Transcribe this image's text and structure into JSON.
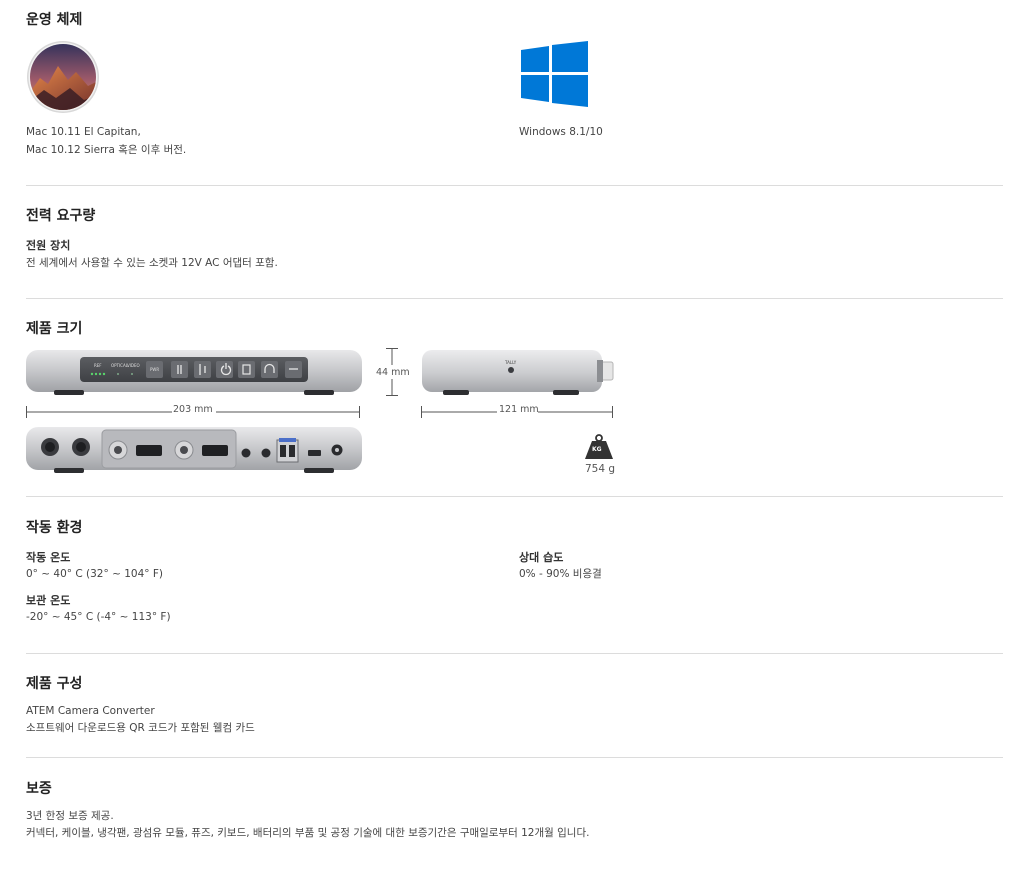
{
  "os": {
    "title": "운영 체제",
    "mac": {
      "line1": "Mac 10.11 El Capitan,",
      "line2": "Mac 10.12 Sierra 혹은 이후 버전."
    },
    "windows": {
      "label": "Windows 8.1/10"
    }
  },
  "power": {
    "title": "전력 요구량",
    "label": "전원 장치",
    "text": "전 세계에서 사용할 수 있는 소켓과 12V AC 어댑터 포함."
  },
  "dimensions": {
    "title": "제품 크기",
    "width": "203 mm",
    "height": "44 mm",
    "depth": "121 mm",
    "weight": "754 g",
    "weight_icon_text": "KG",
    "front_labels": {
      "ref": "REF",
      "optical": "OPTICAL",
      "video": "VIDEO",
      "pwr": "PWR"
    },
    "tally_label": "TALLY"
  },
  "environment": {
    "title": "작동 환경",
    "operating_temp_label": "작동 온도",
    "operating_temp_value": "0° ~ 40° C (32° ~ 104° F)",
    "storage_temp_label": "보관 온도",
    "storage_temp_value": "-20° ~ 45° C (-4° ~ 113° F)",
    "humidity_label": "상대 습도",
    "humidity_value": "0% - 90% 비응결"
  },
  "contents": {
    "title": "제품 구성",
    "items": [
      "ATEM Camera Converter",
      "소프트웨어 다운로드용 QR 코드가 포함된 웰컴 카드"
    ]
  },
  "warranty": {
    "title": "보증",
    "line1": "3년 한정 보증 제공.",
    "line2": "커넥터, 케이블, 냉각팬, 광섬유 모듈, 퓨즈, 키보드, 배터리의 부품 및 공정 기술에 대한 보증기간은 구매일로부터 12개월 입니다."
  },
  "colors": {
    "windows_blue": "#0078d7",
    "divider": "#dcdcdc"
  }
}
